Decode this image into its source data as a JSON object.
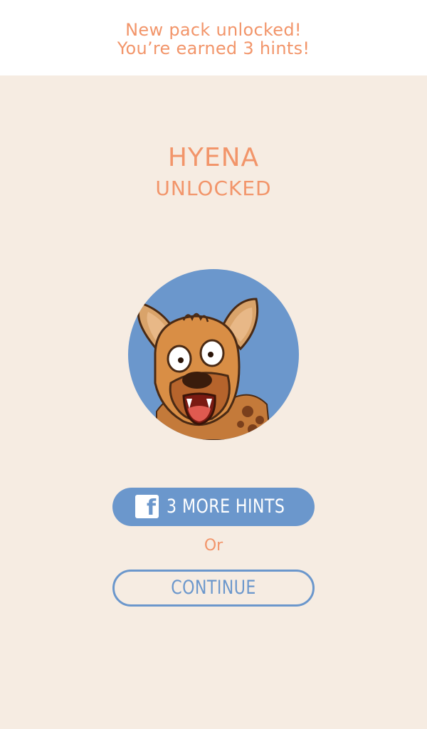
{
  "banner": {
    "line1": "New pack unlocked!",
    "line2": "You’re earned 3 hints!"
  },
  "unlock": {
    "animal": "HYENA",
    "status": "UNLOCKED"
  },
  "avatar": {
    "icon": "hyena-portrait"
  },
  "actions": {
    "facebook_icon": "f",
    "facebook_label": "3 MORE HINTS",
    "separator": "Or",
    "continue_label": "CONTINUE"
  },
  "colors": {
    "accent_orange": "#f2956a",
    "accent_blue": "#6b97cc",
    "panel_background": "#f6ece2"
  }
}
